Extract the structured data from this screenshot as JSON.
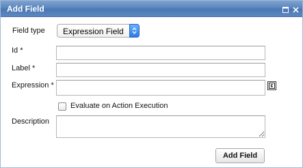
{
  "dialog": {
    "title": "Add Field",
    "maximize_icon": "maximize-icon",
    "close_icon": "close-icon"
  },
  "form": {
    "field_type_label": "Field type",
    "field_type_value": "Expression Field",
    "id_label": "Id *",
    "id_value": "",
    "label_label": "Label *",
    "label_value": "",
    "expression_label": "Expression *",
    "expression_value": "",
    "expression_editor_icon": "expression-editor-icon",
    "evaluate_checkbox_label": "Evaluate on Action Execution",
    "evaluate_checked": false,
    "description_label": "Description",
    "description_value": "",
    "submit_label": "Add Field"
  },
  "colors": {
    "titlebar": "#5a86bf",
    "select_arrow": "#2a7be6"
  }
}
